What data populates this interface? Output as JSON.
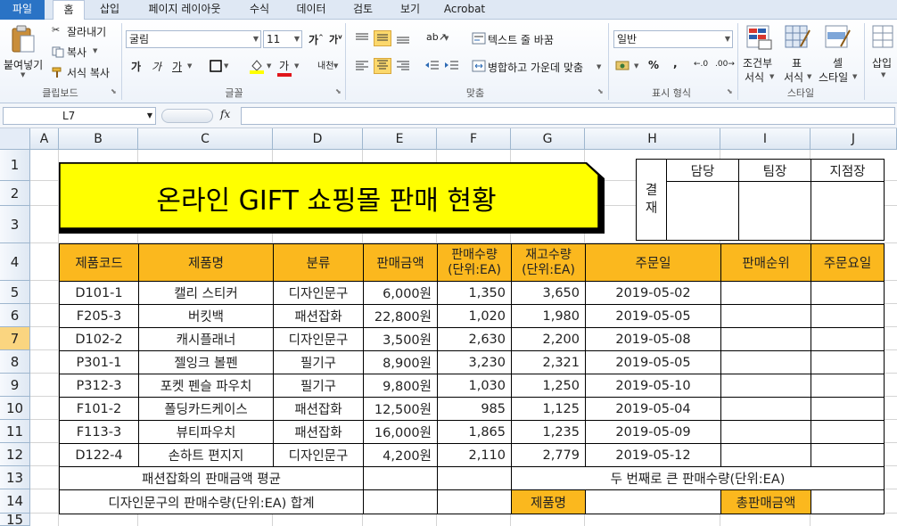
{
  "tabs": [
    "파일",
    "홈",
    "삽입",
    "페이지 레이아웃",
    "수식",
    "데이터",
    "검토",
    "보기",
    "Acrobat"
  ],
  "ribbon": {
    "clipboard": {
      "paste": "붙여넣기",
      "cut": "잘라내기",
      "copy": "복사",
      "format_painter": "서식 복사",
      "group": "클립보드"
    },
    "font": {
      "font_name": "굴림",
      "font_size": "11",
      "bold": "가",
      "italic": "가",
      "underline": "가",
      "group": "글꼴"
    },
    "alignment": {
      "wrap": "텍스트 줄 바꿈",
      "merge": "병합하고 가운데 맞춤",
      "group": "맞춤"
    },
    "number": {
      "format": "일반",
      "percent": "%",
      "comma": ",",
      "group": "표시 형식"
    },
    "styles": {
      "cond_l1": "조건부",
      "cond_l2": "서식",
      "table_l1": "표",
      "table_l2": "서식",
      "cell_l1": "셀",
      "cell_l2": "스타일",
      "group": "스타일"
    },
    "cells": {
      "insert": "삽입"
    }
  },
  "formula_bar": {
    "name_box": "L7",
    "fx": "fx",
    "formula": ""
  },
  "columns": [
    "A",
    "B",
    "C",
    "D",
    "E",
    "F",
    "G",
    "H",
    "I",
    "J"
  ],
  "rows": [
    "1",
    "2",
    "3",
    "4",
    "5",
    "6",
    "7",
    "8",
    "9",
    "10",
    "11",
    "12",
    "13",
    "14",
    "15"
  ],
  "selected": {
    "row": "7"
  },
  "sheet": {
    "title": "온라인 GIFT 쇼핑몰 판매 현황",
    "approval": {
      "label_1": "결",
      "label_2": "재",
      "c1": "담당",
      "c2": "팀장",
      "c3": "지점장"
    },
    "headers": {
      "code": "제품코드",
      "name": "제품명",
      "category": "분류",
      "price": "판매금액",
      "sold_1": "판매수량",
      "sold_2": "(단위:EA)",
      "stock_1": "재고수량",
      "stock_2": "(단위:EA)",
      "date": "주문일",
      "rank": "판매순위",
      "day": "주문요일"
    },
    "data_rows": [
      {
        "code": "D101-1",
        "name": "캘리 스티커",
        "category": "디자인문구",
        "price": "6,000원",
        "sold": "1,350",
        "stock": "3,650",
        "date": "2019-05-02"
      },
      {
        "code": "F205-3",
        "name": "버킷백",
        "category": "패션잡화",
        "price": "22,800원",
        "sold": "1,020",
        "stock": "1,980",
        "date": "2019-05-05"
      },
      {
        "code": "D102-2",
        "name": "캐시플래너",
        "category": "디자인문구",
        "price": "3,500원",
        "sold": "2,630",
        "stock": "2,200",
        "date": "2019-05-08"
      },
      {
        "code": "P301-1",
        "name": "젤잉크 볼펜",
        "category": "필기구",
        "price": "8,900원",
        "sold": "3,230",
        "stock": "2,321",
        "date": "2019-05-05"
      },
      {
        "code": "P312-3",
        "name": "포켓 펜슬 파우치",
        "category": "필기구",
        "price": "9,800원",
        "sold": "1,030",
        "stock": "1,250",
        "date": "2019-05-10"
      },
      {
        "code": "F101-2",
        "name": "폴딩카드케이스",
        "category": "패션잡화",
        "price": "12,500원",
        "sold": "985",
        "stock": "1,125",
        "date": "2019-05-04"
      },
      {
        "code": "F113-3",
        "name": "뷰티파우치",
        "category": "패션잡화",
        "price": "16,000원",
        "sold": "1,865",
        "stock": "1,235",
        "date": "2019-05-09"
      },
      {
        "code": "D122-4",
        "name": "손하트 편지지",
        "category": "디자인문구",
        "price": "4,200원",
        "sold": "2,110",
        "stock": "2,779",
        "date": "2019-05-12"
      }
    ],
    "summary": {
      "avg_fashion": "패션잡화의 판매금액 평균",
      "sum_design": "디자인문구의 판매수량(단위:EA) 합계",
      "second_max": "두 번째로 큰 판매수량(단위:EA)",
      "product_name": "제품명",
      "total_sales": "총판매금액"
    }
  }
}
